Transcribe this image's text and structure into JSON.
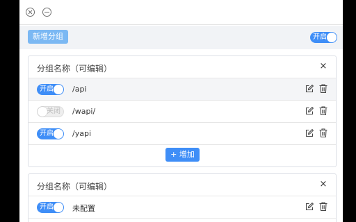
{
  "toolbar": {
    "add_group_label": "新增分组",
    "master_toggle_label": "开启"
  },
  "groups": [
    {
      "title": "分组名称（可编辑）",
      "close_label": "×",
      "rules": [
        {
          "enabled": true,
          "toggle_label": "开启",
          "path": "/api"
        },
        {
          "enabled": false,
          "toggle_label": "关闭",
          "path": "/wapi/"
        },
        {
          "enabled": true,
          "toggle_label": "开启",
          "path": "/yapi"
        }
      ],
      "add_rule_label": "+ 增加"
    },
    {
      "title": "分组名称（可编辑）",
      "close_label": "×",
      "rules": [
        {
          "enabled": true,
          "toggle_label": "开启",
          "path": "未配置"
        }
      ]
    }
  ],
  "colors": {
    "accent": "#3f8ef7",
    "accent_light": "#7bb8f3"
  }
}
